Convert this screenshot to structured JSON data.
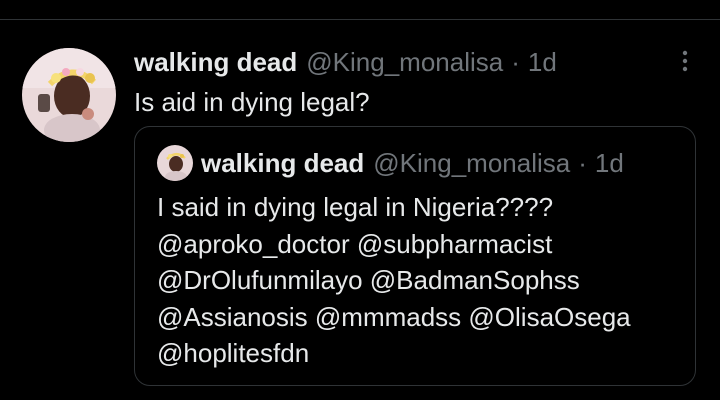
{
  "tweet": {
    "display_name": "walking dead",
    "handle": "@King_monalisa",
    "separator": "·",
    "time": "1d",
    "text": "Is aid in dying legal?"
  },
  "quoted_tweet": {
    "display_name": "walking dead",
    "handle": "@King_monalisa",
    "separator": "·",
    "time": "1d",
    "lines": [
      "I said in dying legal in Nigeria????",
      "@aproko_doctor @subpharmacist",
      "@DrOlufunmilayo @BadmanSophss",
      "@Assianosis @mmmadss @OlisaOsega",
      "@hoplitesfdn"
    ]
  },
  "icons": {
    "more": "more-vertical-icon"
  },
  "colors": {
    "background": "#000000",
    "primary_text": "#e7e9ea",
    "secondary_text": "#71767b",
    "border": "#2f3336"
  }
}
